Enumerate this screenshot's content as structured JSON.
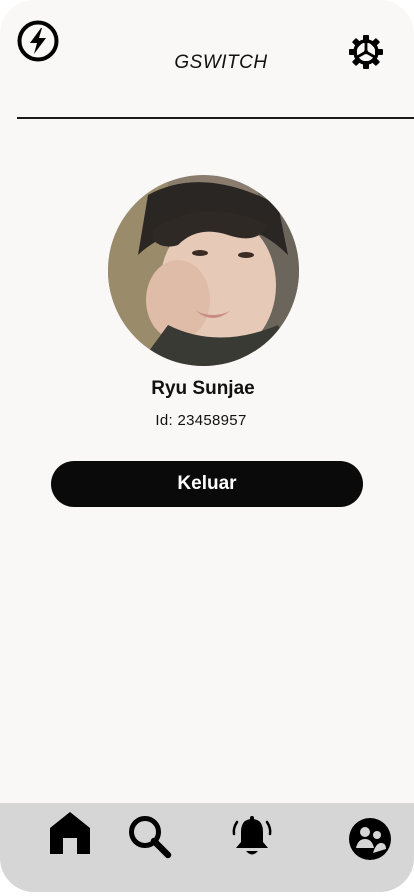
{
  "header": {
    "app_title": "GSWITCH",
    "left_icon": "lightning-bolt-icon",
    "right_icon": "gear-icon"
  },
  "profile": {
    "name": "Ryu Sunjae",
    "id_text": "Id: 23458957"
  },
  "actions": {
    "logout_label": "Keluar"
  },
  "bottom_nav": {
    "items": [
      {
        "icon": "home-icon"
      },
      {
        "icon": "search-icon"
      },
      {
        "icon": "bell-icon"
      },
      {
        "icon": "profile-icon"
      }
    ]
  },
  "colors": {
    "background": "#faf8f7",
    "primary_button": "#0a0a0a",
    "nav_background": "#d6d6d6"
  }
}
